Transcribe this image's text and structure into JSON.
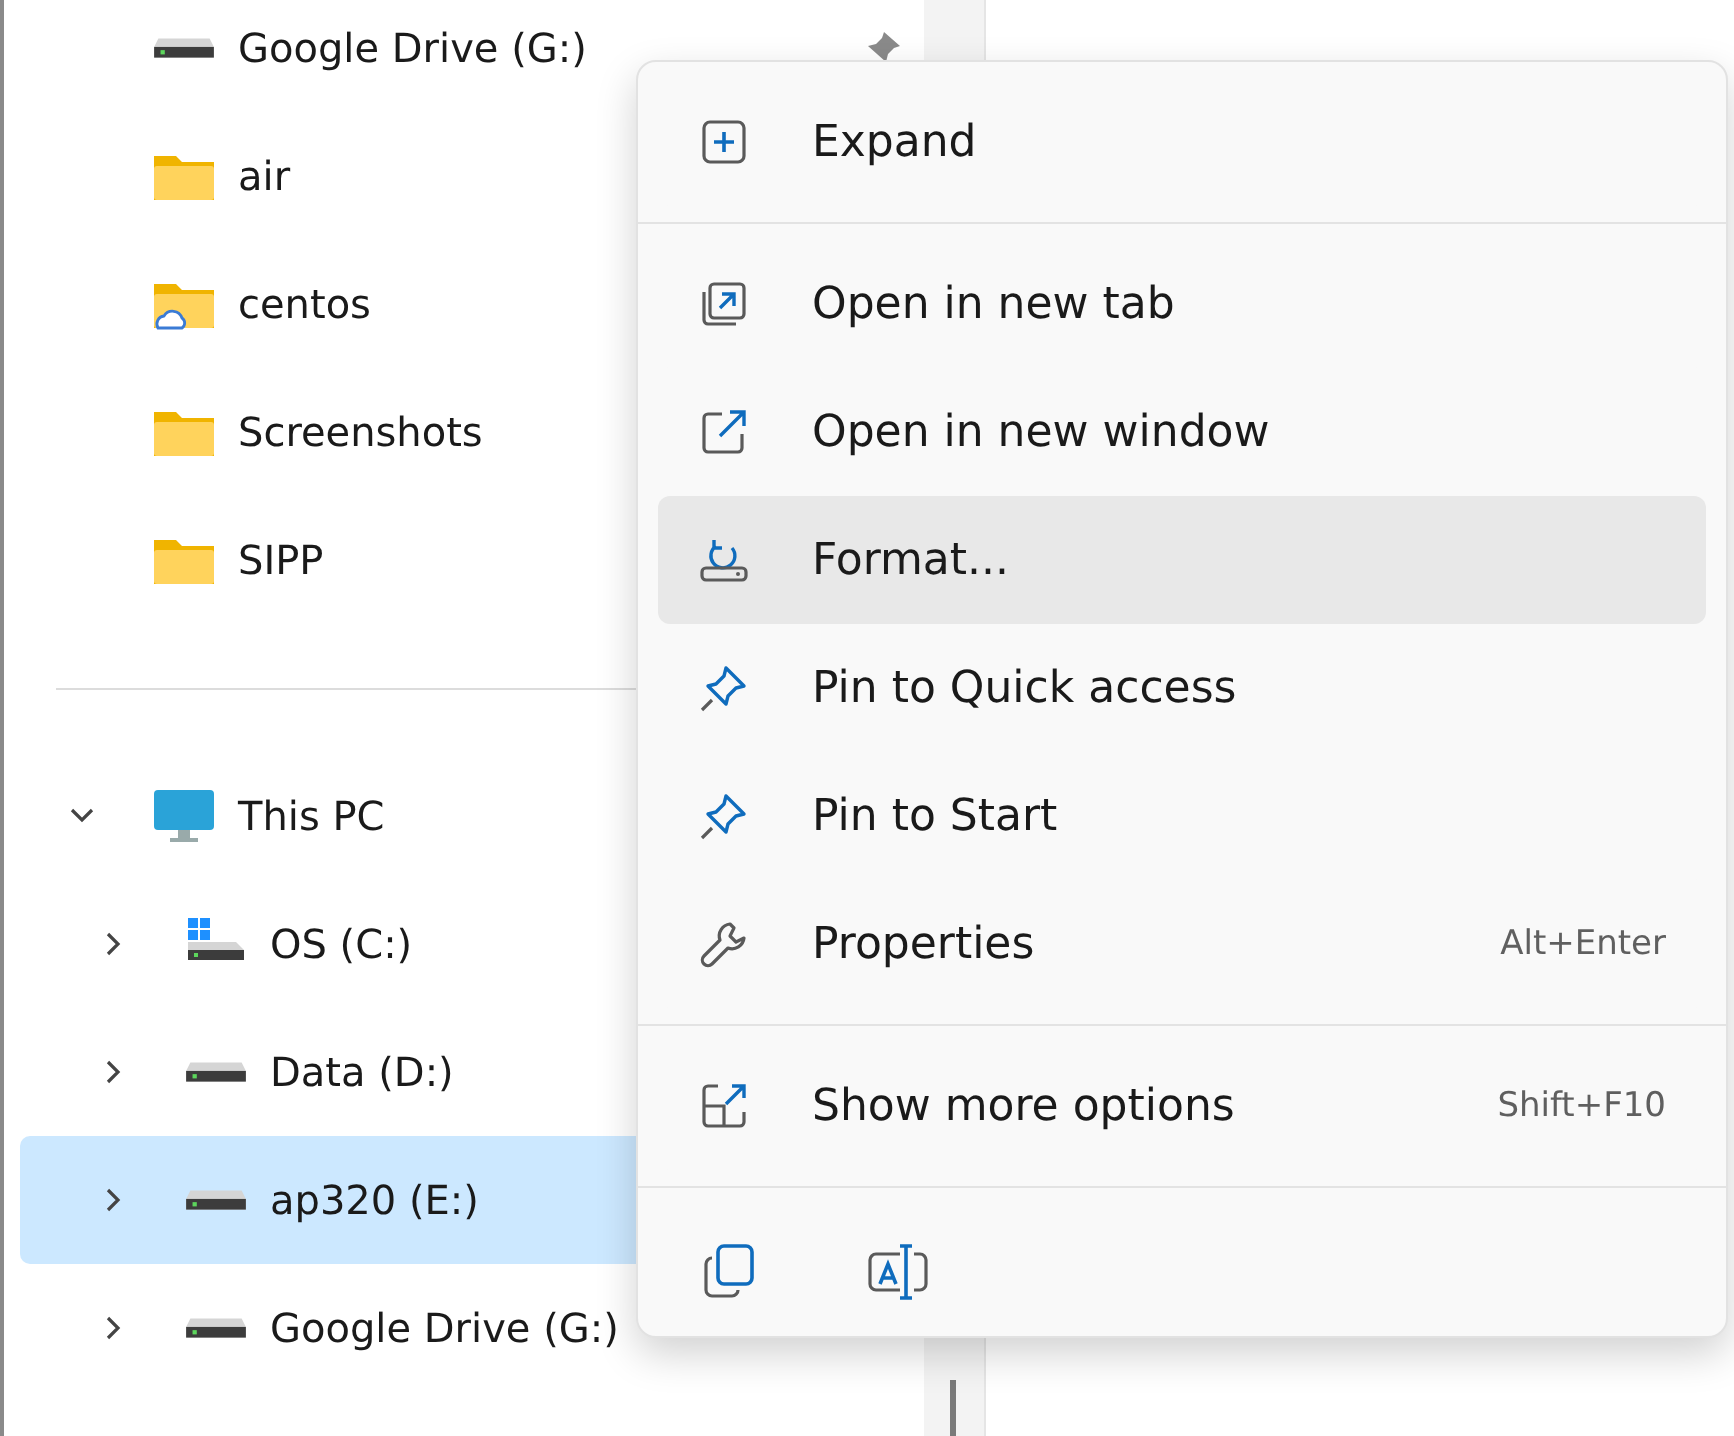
{
  "sidebar": {
    "items": [
      {
        "label": "Google Drive (G:)",
        "kind": "drive",
        "selected": false,
        "pinned": true
      },
      {
        "label": "air",
        "kind": "folder",
        "selected": false
      },
      {
        "label": "centos",
        "kind": "cloud-folder",
        "selected": false
      },
      {
        "label": "Screenshots",
        "kind": "folder",
        "selected": false
      },
      {
        "label": "SIPP",
        "kind": "folder",
        "selected": false
      },
      {
        "kind": "divider"
      },
      {
        "label": "This PC",
        "kind": "pc",
        "selected": false,
        "expanded": true,
        "children": [
          {
            "label": "OS (C:)",
            "kind": "os-drive",
            "selected": false,
            "expanded": false
          },
          {
            "label": "Data (D:)",
            "kind": "drive",
            "selected": false,
            "expanded": false
          },
          {
            "label": "ap320 (E:)",
            "kind": "drive",
            "selected": true,
            "expanded": false
          },
          {
            "label": "Google Drive (G:)",
            "kind": "drive",
            "selected": false,
            "expanded": false
          }
        ]
      }
    ]
  },
  "context_menu": {
    "groups": [
      [
        {
          "label": "Expand",
          "kind": "expand",
          "hovered": false
        }
      ],
      [
        {
          "label": "Open in new tab",
          "kind": "new-tab",
          "hovered": false
        },
        {
          "label": "Open in new window",
          "kind": "new-window",
          "hovered": false
        },
        {
          "label": "Format...",
          "kind": "format",
          "hovered": true
        },
        {
          "label": "Pin to Quick access",
          "kind": "pin",
          "hovered": false
        },
        {
          "label": "Pin to Start",
          "kind": "pin",
          "hovered": false
        },
        {
          "label": "Properties",
          "kind": "wrench",
          "hovered": false,
          "shortcut": "Alt+Enter"
        }
      ],
      [
        {
          "label": "Show more options",
          "kind": "more",
          "hovered": false,
          "shortcut": "Shift+F10"
        }
      ]
    ],
    "toolbar": [
      {
        "kind": "copy"
      },
      {
        "kind": "rename"
      }
    ]
  }
}
